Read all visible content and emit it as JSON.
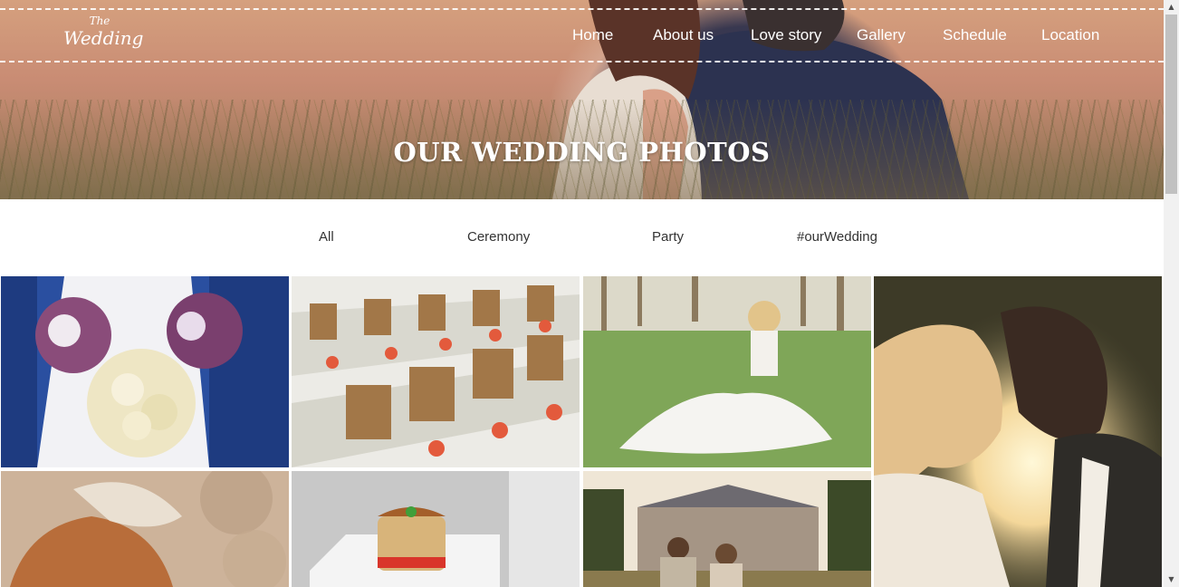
{
  "header": {
    "logo": {
      "line1": "The",
      "line2": "Wedding"
    },
    "nav": [
      "Home",
      "About us",
      "Love story",
      "Gallery",
      "Schedule",
      "Location"
    ]
  },
  "hero": {
    "title": "OUR WEDDING PHOTOS"
  },
  "filters": [
    "All",
    "Ceremony",
    "Party",
    "#ourWedding"
  ],
  "gallery": {
    "photos": [
      {
        "name": "bouquets-photo",
        "subject": "bridesmaids bouquets"
      },
      {
        "name": "reception-tables-photo",
        "subject": "reception tables"
      },
      {
        "name": "bride-in-grass-photo",
        "subject": "bride sitting on grass"
      },
      {
        "name": "couple-kiss-photo",
        "subject": "couple kissing at sunset"
      },
      {
        "name": "bride-veil-photo",
        "subject": "bride hair with veil"
      },
      {
        "name": "dessert-photo",
        "subject": "wedding dessert"
      },
      {
        "name": "couple-palace-photo",
        "subject": "couple in front of palace"
      }
    ]
  },
  "icons": {
    "scroll_up": "triangle-up-icon",
    "scroll_down": "triangle-down-icon"
  }
}
